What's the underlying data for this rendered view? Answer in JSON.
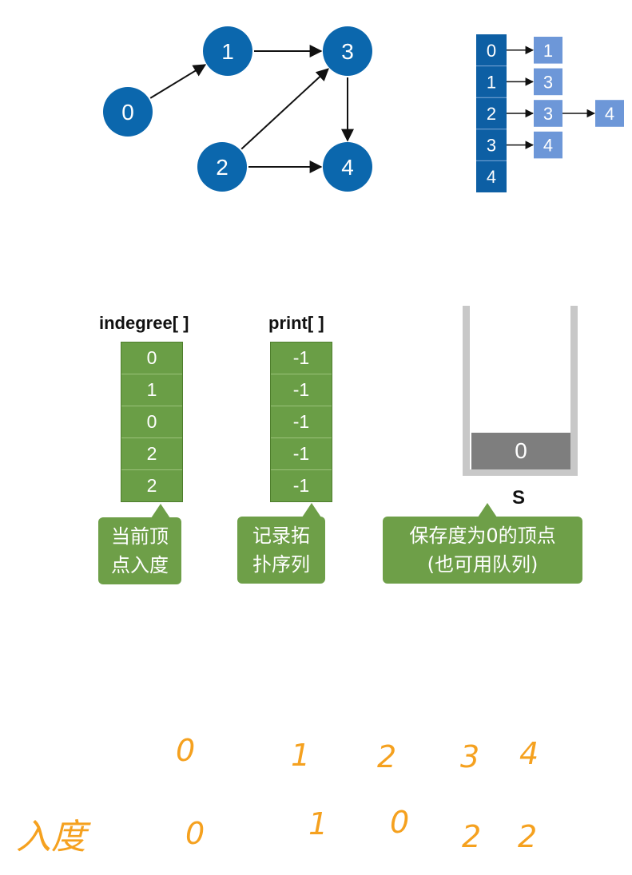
{
  "graph": {
    "nodes": [
      "0",
      "1",
      "2",
      "3",
      "4"
    ],
    "edges": [
      [
        "0",
        "1"
      ],
      [
        "1",
        "3"
      ],
      [
        "2",
        "3"
      ],
      [
        "2",
        "4"
      ],
      [
        "3",
        "4"
      ]
    ]
  },
  "adjacency": {
    "heads": [
      "0",
      "1",
      "2",
      "3",
      "4"
    ],
    "lists": [
      [
        "1"
      ],
      [
        "3"
      ],
      [
        "3",
        "4"
      ],
      [
        "4"
      ],
      []
    ]
  },
  "indegree": {
    "title": "indegree[ ]",
    "values": [
      "0",
      "1",
      "0",
      "2",
      "2"
    ],
    "callout": [
      "当前顶",
      "点入度"
    ]
  },
  "print": {
    "title": "print[ ]",
    "values": [
      "-1",
      "-1",
      "-1",
      "-1",
      "-1"
    ],
    "callout": [
      "记录拓",
      "扑序列"
    ]
  },
  "stack": {
    "items": [
      "0"
    ],
    "label": "S",
    "callout": [
      "保存度为0的顶点",
      "(也可用队列)"
    ]
  },
  "handwritten": {
    "vertices": [
      "0",
      "1",
      "2",
      "3",
      "4"
    ],
    "row_label": "入度",
    "degrees": [
      "0",
      "1",
      "0",
      "2",
      "2"
    ]
  },
  "colors": {
    "node_fill": "#0b67ad",
    "adj_head": "#0d5fa4",
    "adj_node": "#6d97d8",
    "array_fill": "#6a9e46",
    "handwriting": "#f5a11f"
  }
}
